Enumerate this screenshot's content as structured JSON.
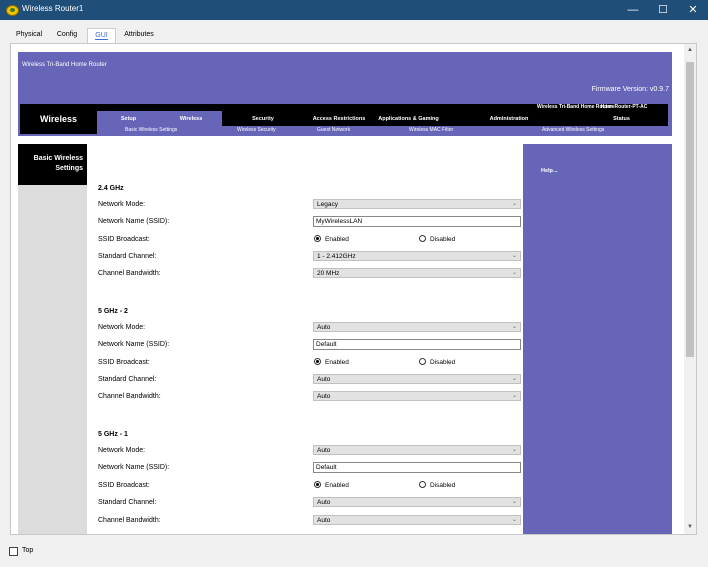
{
  "window": {
    "title": "Wireless Router1",
    "minimize_glyph": "—",
    "maximize_glyph": "☐",
    "close_glyph": "✕"
  },
  "tabs": [
    {
      "label": "Physical"
    },
    {
      "label": "Config"
    },
    {
      "label": "GUI"
    },
    {
      "label": "Attributes"
    }
  ],
  "active_tab": "GUI",
  "banner": {
    "product": "Wireless Tri-Band Home Router",
    "firmware": "Firmware Version: v0.9.7"
  },
  "nav": {
    "brand": "Wireless",
    "product_name": "Wireless Tri-Band Home Router",
    "model": "HomeRouter-PT-AC",
    "menu": [
      {
        "label": "Setup"
      },
      {
        "label": "Wireless"
      },
      {
        "label": "Security"
      },
      {
        "label": "Access Restrictions"
      },
      {
        "label": "Applications & Gaming"
      },
      {
        "label": "Administration"
      },
      {
        "label": "Status"
      }
    ],
    "submenu": [
      {
        "label": "Basic Wireless Settings"
      },
      {
        "label": "Wireless Security"
      },
      {
        "label": "Guest Network"
      },
      {
        "label": "Wireless MAC Filter"
      },
      {
        "label": "Advanced Wireless Settings"
      }
    ]
  },
  "sidebar": {
    "title_line1": "Basic Wireless",
    "title_line2": "Settings"
  },
  "help": {
    "label": "Help..."
  },
  "labels": {
    "network_mode": "Network Mode:",
    "ssid": "Network Name (SSID):",
    "broadcast": "SSID Broadcast:",
    "channel": "Standard Channel:",
    "bandwidth": "Channel Bandwidth:",
    "enabled": "Enabled",
    "disabled": "Disabled"
  },
  "sections": [
    {
      "title": "2.4 GHz",
      "network_mode": "Legacy",
      "ssid": "MyWirelessLAN",
      "broadcast": "Enabled",
      "channel": "1 - 2.412GHz",
      "bandwidth": "20 MHz"
    },
    {
      "title": "5 GHz - 2",
      "network_mode": "Auto",
      "ssid": "Default",
      "broadcast": "Enabled",
      "channel": "Auto",
      "bandwidth": "Auto"
    },
    {
      "title": "5 GHz - 1",
      "network_mode": "Auto",
      "ssid": "Default",
      "broadcast": "Enabled",
      "channel": "Auto",
      "bandwidth": "Auto"
    }
  ],
  "footer": {
    "top_label": "Top",
    "top_checked": false
  }
}
